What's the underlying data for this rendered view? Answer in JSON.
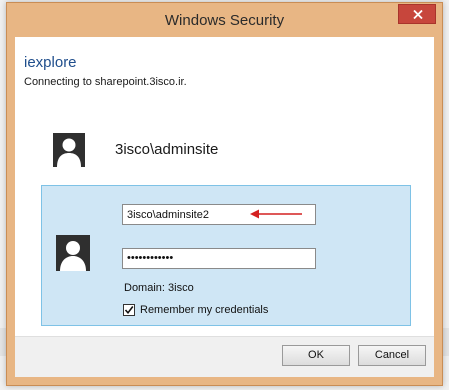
{
  "window": {
    "title": "Windows Security",
    "close_label": "×"
  },
  "header": {
    "app_name": "iexplore",
    "message": "Connecting to sharepoint.3isco.ir."
  },
  "stored_credential": {
    "user": "3isco\\adminsite",
    "icon": "user-icon"
  },
  "credential_panel": {
    "username_value": "3isco\\adminsite2",
    "password_value": "••••••••••••",
    "domain_text": "Domain: 3isco",
    "remember_label": "Remember my credentials",
    "remember_checked": true,
    "annotation_arrow_color": "#d42020"
  },
  "footer": {
    "ok_label": "OK",
    "cancel_label": "Cancel"
  },
  "colors": {
    "title_bar": "#e8b684",
    "close_button": "#c7463c",
    "panel_bg": "#cfe6f5",
    "panel_border": "#7ec2e6",
    "link_blue": "#1f4e8c"
  }
}
